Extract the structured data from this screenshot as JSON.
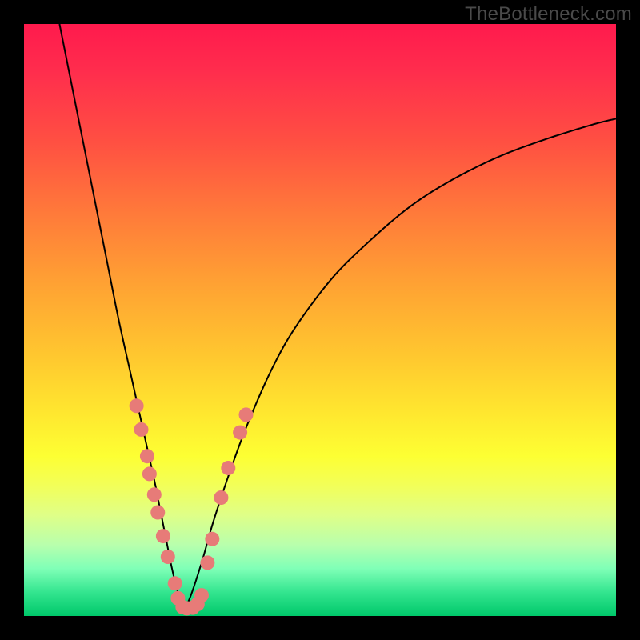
{
  "watermark": "TheBottleneck.com",
  "chart_data": {
    "type": "line",
    "title": "",
    "xlabel": "",
    "ylabel": "",
    "xlim": [
      0,
      100
    ],
    "ylim": [
      0,
      100
    ],
    "note": "Bottleneck V-curve. Two arms descend to a narrow minimum near x≈27. Salmon dots cluster along the lower portions of both arms. Background is a vertical spectrum gradient (red→green) indicating worse→better.",
    "series": [
      {
        "name": "left-arm",
        "x": [
          6,
          8,
          10,
          12,
          14,
          16,
          18,
          20,
          22,
          23,
          24,
          25,
          26,
          27
        ],
        "y": [
          100,
          90,
          80,
          70,
          60,
          50,
          41,
          32,
          23,
          18,
          13,
          8,
          4,
          1.5
        ]
      },
      {
        "name": "right-arm",
        "x": [
          27,
          28,
          30,
          32,
          35,
          38,
          42,
          46,
          52,
          58,
          65,
          72,
          80,
          88,
          96,
          100
        ],
        "y": [
          1.5,
          3,
          9,
          16,
          25,
          33,
          42,
          49,
          57,
          63,
          69,
          73.5,
          77.5,
          80.5,
          83,
          84
        ]
      }
    ],
    "dots": {
      "name": "highlight-points",
      "color": "#e77b78",
      "points": [
        {
          "x": 19.0,
          "y": 35.5
        },
        {
          "x": 19.8,
          "y": 31.5
        },
        {
          "x": 20.8,
          "y": 27.0
        },
        {
          "x": 21.2,
          "y": 24.0
        },
        {
          "x": 22.0,
          "y": 20.5
        },
        {
          "x": 22.6,
          "y": 17.5
        },
        {
          "x": 23.5,
          "y": 13.5
        },
        {
          "x": 24.3,
          "y": 10.0
        },
        {
          "x": 25.5,
          "y": 5.5
        },
        {
          "x": 26.0,
          "y": 3.0
        },
        {
          "x": 26.8,
          "y": 1.5
        },
        {
          "x": 27.5,
          "y": 1.3
        },
        {
          "x": 28.5,
          "y": 1.4
        },
        {
          "x": 29.3,
          "y": 2.0
        },
        {
          "x": 30.0,
          "y": 3.5
        },
        {
          "x": 31.0,
          "y": 9.0
        },
        {
          "x": 31.8,
          "y": 13.0
        },
        {
          "x": 33.3,
          "y": 20.0
        },
        {
          "x": 34.5,
          "y": 25.0
        },
        {
          "x": 36.5,
          "y": 31.0
        },
        {
          "x": 37.5,
          "y": 34.0
        }
      ]
    }
  }
}
